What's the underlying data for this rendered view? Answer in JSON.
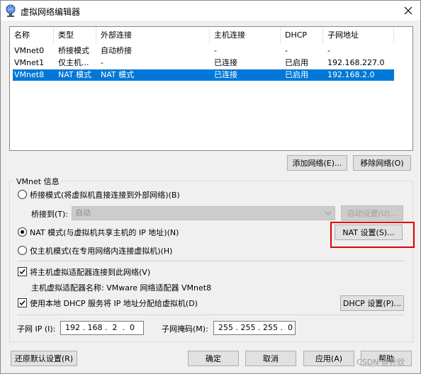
{
  "window": {
    "title": "虚拟网络编辑器"
  },
  "list": {
    "columns": [
      "名称",
      "类型",
      "外部连接",
      "主机连接",
      "DHCP",
      "子网地址"
    ],
    "rows": [
      {
        "name": "VMnet0",
        "type": "桥接模式",
        "external": "自动桥接",
        "host": "-",
        "dhcp": "-",
        "subnet": "-"
      },
      {
        "name": "VMnet1",
        "type": "仅主机...",
        "external": "-",
        "host": "已连接",
        "dhcp": "已启用",
        "subnet": "192.168.227.0"
      },
      {
        "name": "VMnet8",
        "type": "NAT 模式",
        "external": "NAT 模式",
        "host": "已连接",
        "dhcp": "已启用",
        "subnet": "192.168.2.0",
        "selected": true
      }
    ]
  },
  "buttons": {
    "add_network": "添加网络(E)...",
    "remove_network": "移除网络(O)",
    "auto_settings": "自动设置(U)...",
    "nat_settings": "NAT 设置(S)...",
    "dhcp_settings": "DHCP 设置(P)...",
    "restore_defaults": "还原默认设置(R)",
    "ok": "确定",
    "cancel": "取消",
    "apply": "应用(A)",
    "help": "帮助"
  },
  "vmnet_info": {
    "group_label": "VMnet 信息",
    "bridged_radio": "桥接模式(将虚拟机直接连接到外部网络)(B)",
    "bridge_to_label": "桥接到(T):",
    "bridge_to_value": "自动",
    "nat_radio": "NAT 模式(与虚拟机共享主机的 IP 地址)(N)",
    "hostonly_radio": "仅主机模式(在专用网络内连接虚拟机)(H)",
    "selected_mode": "nat",
    "connect_adapter_checkbox": "将主机虚拟适配器连接到此网络(V)",
    "connect_adapter_checked": true,
    "adapter_name_label": "主机虚拟适配器名称: VMware 网络适配器 VMnet8",
    "use_dhcp_checkbox": "使用本地 DHCP 服务将 IP 地址分配给虚拟机(D)",
    "use_dhcp_checked": true,
    "subnet_ip_label": "子网 IP (I):",
    "subnet_ip_value": "192 . 168 .  2  .  0",
    "subnet_mask_label": "子网掩码(M):",
    "subnet_mask_value": "255 . 255 . 255 .  0"
  },
  "watermark": "CSDN @乔欣"
}
